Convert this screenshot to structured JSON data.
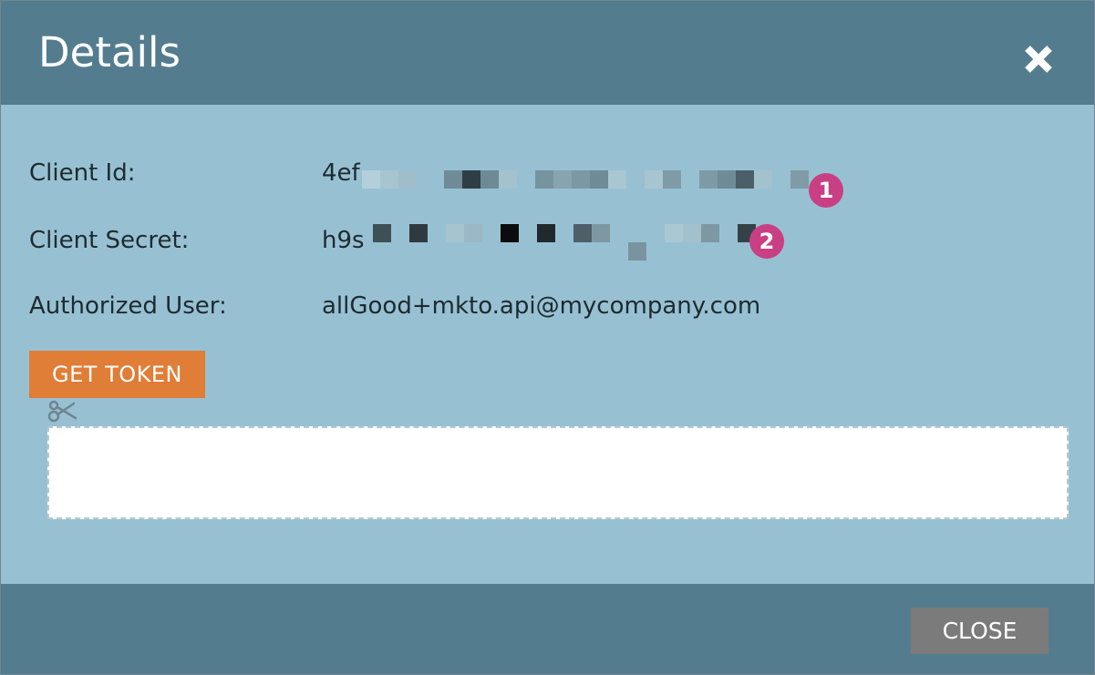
{
  "dialog": {
    "title": "Details",
    "close_icon": "close-icon"
  },
  "fields": {
    "client_id": {
      "label": "Client Id:",
      "value_prefix": "4ef"
    },
    "client_secret": {
      "label": "Client Secret:",
      "value_prefix": "h9s"
    },
    "authorized_user": {
      "label": "Authorized User:",
      "value": "allGood+mkto.api@mycompany.com"
    }
  },
  "badges": {
    "first": "1",
    "second": "2"
  },
  "buttons": {
    "get_token": "GET TOKEN",
    "close": "CLOSE"
  },
  "icons": {
    "copy": "scissors-icon"
  },
  "colors": {
    "header_bg": "#537d8e",
    "body_bg": "#97c1d2",
    "accent_button": "#e07d37",
    "close_button": "#7b7b7b",
    "badge": "#c93f84"
  }
}
